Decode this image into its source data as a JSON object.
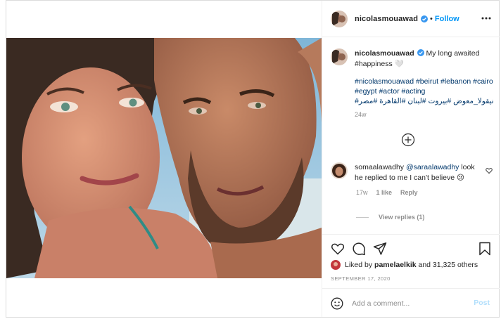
{
  "header": {
    "username": "nicolasmouawad",
    "separator": "•",
    "follow_label": "Follow"
  },
  "caption": {
    "username": "nicolasmouawad",
    "text": "My long awaited #happiness 🤍",
    "hashtags": "#nicolasmouawad #beirut #lebanon #cairo #egypt #actor #acting",
    "arabic_hashtags": "#نيقولا_معوض #بيروت #لبنان #القاهرة #مصر",
    "age": "24w"
  },
  "comment": {
    "username": "somaalawadhy",
    "mention": "@saraalawadhy",
    "text": "look he replied to me I can't believe 😢",
    "age": "17w",
    "likes": "1 like",
    "reply_label": "Reply",
    "view_replies": "View replies (1)"
  },
  "likes": {
    "prefix": "Liked by",
    "user": "pamelaelkik",
    "suffix": "and 31,325 others"
  },
  "date": "SEPTEMBER 17, 2020",
  "add_comment": {
    "placeholder": "Add a comment...",
    "post_label": "Post"
  },
  "icons": {
    "like": "heart-icon",
    "comment": "comment-icon",
    "share": "share-icon",
    "save": "bookmark-icon",
    "more": "more-icon",
    "emoji": "emoji-icon",
    "add": "plus-circle-icon",
    "verified": "verified-badge-icon"
  },
  "colors": {
    "link": "#00376b",
    "follow": "#0095f6",
    "muted": "#8e8e8e",
    "post_disabled": "#b2dffc",
    "border": "#dbdbdb"
  }
}
